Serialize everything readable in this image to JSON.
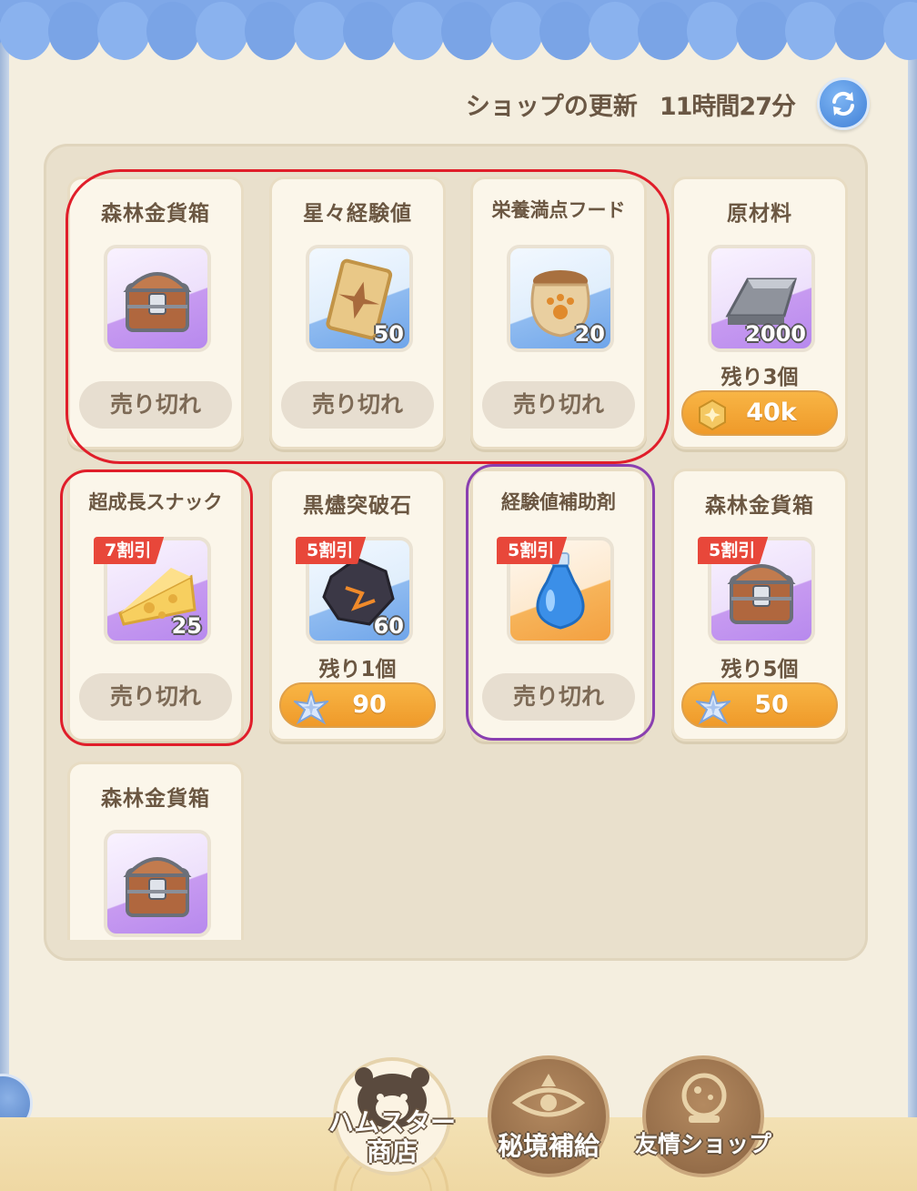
{
  "header": {
    "refresh_label": "ショップの更新",
    "refresh_timer": "11時間27分"
  },
  "items": [
    {
      "name": "森林金貨箱",
      "icon": "treasure-chest-icon",
      "rarity": "purple",
      "quantity": "",
      "discount": "",
      "stock": "",
      "status": "売り切れ",
      "price": ""
    },
    {
      "name": "星々経験値",
      "icon": "star-card-icon",
      "rarity": "blue",
      "quantity": "50",
      "discount": "",
      "stock": "",
      "status": "売り切れ",
      "price": ""
    },
    {
      "name": "栄養満点フード",
      "icon": "food-sack-icon",
      "rarity": "blue",
      "quantity": "20",
      "discount": "",
      "stock": "",
      "status": "売り切れ",
      "price": ""
    },
    {
      "name": "原材料",
      "icon": "metal-ingot-icon",
      "rarity": "purple",
      "quantity": "2000",
      "discount": "",
      "stock": "残り3個",
      "status": "",
      "price": "40k",
      "currency": "gold-coin-icon"
    },
    {
      "name": "超成長スナック",
      "icon": "cheese-icon",
      "rarity": "purple",
      "quantity": "25",
      "discount": "7割引",
      "stock": "",
      "status": "売り切れ",
      "price": ""
    },
    {
      "name": "黒燼突破石",
      "icon": "ember-stone-icon",
      "rarity": "blue",
      "quantity": "60",
      "discount": "5割引",
      "stock": "残り1個",
      "status": "",
      "price": "90",
      "currency": "star-crystal-icon"
    },
    {
      "name": "経験値補助剤",
      "icon": "potion-icon",
      "rarity": "orange",
      "quantity": "",
      "discount": "5割引",
      "stock": "",
      "status": "売り切れ",
      "price": ""
    },
    {
      "name": "森林金貨箱",
      "icon": "treasure-chest-icon",
      "rarity": "purple",
      "quantity": "",
      "discount": "5割引",
      "stock": "残り5個",
      "status": "",
      "price": "50",
      "currency": "star-crystal-icon"
    },
    {
      "name": "森林金貨箱",
      "icon": "treasure-chest-icon",
      "rarity": "purple",
      "quantity": "",
      "discount": "",
      "stock": "",
      "status": "",
      "price": ""
    }
  ],
  "nav": {
    "hamster_shop_line1": "ハムスター",
    "hamster_shop_line2": "商店",
    "secret_supply": "秘境補給",
    "friendship_shop": "友情ショップ"
  },
  "colors": {
    "highlight_red": "#e01e2a",
    "highlight_purple": "#8a3fb0",
    "price_orange": "#f2a332",
    "awning_blue": "#7fa8e8"
  }
}
